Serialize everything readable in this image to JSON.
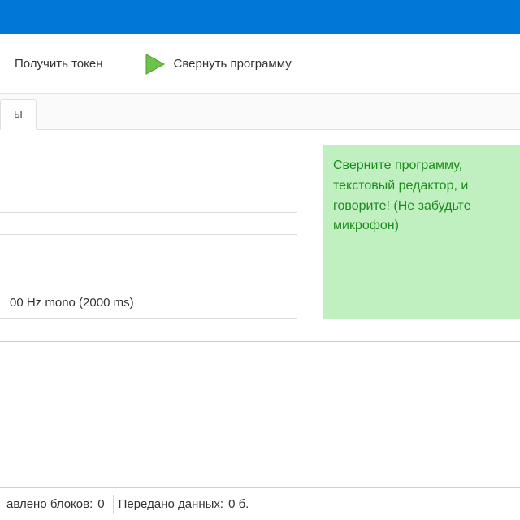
{
  "toolbar": {
    "get_token_label": "Получить токен",
    "minimize_label": "Свернуть программу"
  },
  "tabs": {
    "tab1_label": "ы"
  },
  "audio": {
    "format_line": "00 Hz mono (2000 ms)"
  },
  "hint": {
    "text": "Сверните программу, текстовый редактор, и говорите! (Не забудьте микрофон)"
  },
  "status": {
    "blocks_label": "авлено блоков:",
    "blocks_value": "0",
    "bytes_label": "Передано данных:",
    "bytes_value": "0 б."
  },
  "icons": {
    "play": "play-icon"
  },
  "colors": {
    "titlebar": "#0078d7",
    "note_bg": "#c0f0c0",
    "note_fg": "#1f8b1f"
  }
}
